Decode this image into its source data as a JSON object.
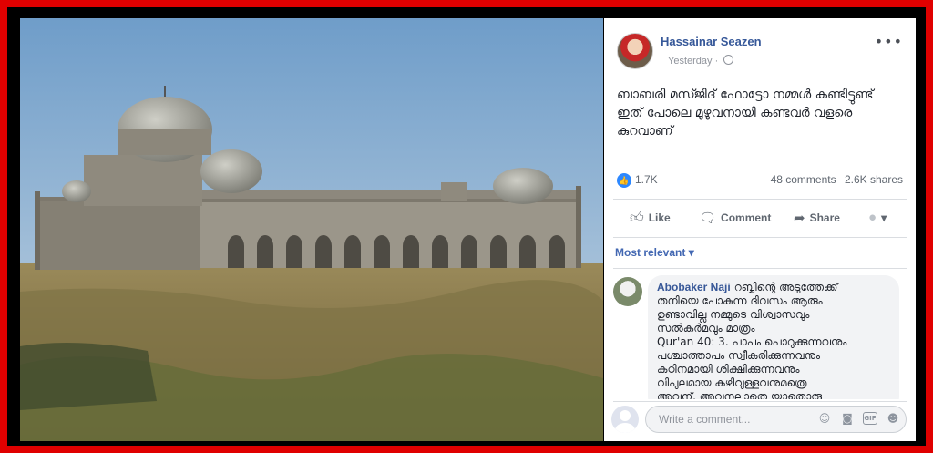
{
  "post": {
    "author": "Hassainar Seazen",
    "time": "Yesterday",
    "privacy_icon": "globe-icon",
    "text_lines": [
      "ബാബരി മസ്ജിദ് ഫോട്ടോ നമ്മൾ കണ്ടിട്ടുണ്ട്",
      "ഇത് പോലെ മുഴുവനായി കണ്ടവർ വളരെ",
      "കുറവാണ്"
    ],
    "reactions_count": "1.7K",
    "comments_count": "48 comments",
    "shares_count": "2.6K shares"
  },
  "actions": {
    "like_label": "Like",
    "comment_label": "Comment",
    "share_label": "Share"
  },
  "sort_label": "Most relevant ▾",
  "comment": {
    "author": "Abobaker Naji",
    "text_lines": [
      "റബ്ബിന്റെ അടുത്തേക്ക്",
      "തനിയെ പോകുന്ന ദിവസം ആരും",
      "ഉണ്ടാവില്ല നമ്മുടെ വിശ്വാസവും",
      "സൽകർമവും മാത്രം",
      "Qur'an 40: 3. പാപം പൊറുക്കുന്നവനും",
      "പശ്ചാത്താപം സ്വീകരിക്കുന്നവനും",
      "കഠിനമായി ശിക്ഷിക്കുന്നവനും",
      "വിപുലമായ കഴിവുള്ളവനുമത്രെ",
      "അവന്. അവനല്ലാതെ യാതൊരു"
    ]
  },
  "composer": {
    "placeholder": "Write a comment...",
    "icons": [
      "emoji-icon",
      "camera-icon",
      "gif-icon",
      "sticker-icon"
    ]
  },
  "colors": {
    "border": "#e00000",
    "link": "#365899",
    "accent": "#4267b2"
  }
}
